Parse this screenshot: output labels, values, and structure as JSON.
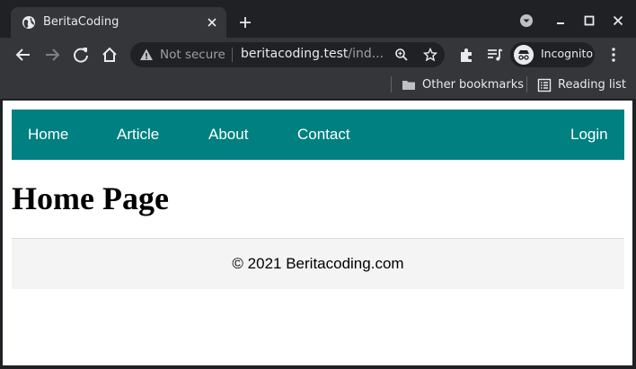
{
  "browser": {
    "tab": {
      "title": "BeritaCoding",
      "favicon": "globe-icon"
    },
    "omnibox": {
      "security_label": "Not secure",
      "url_host": "beritacoding.test",
      "url_path": "/ind..."
    },
    "profile": {
      "label": "Incognito"
    },
    "bookmarks": [
      {
        "label": "Other bookmarks",
        "icon": "folder-icon"
      },
      {
        "label": "Reading list",
        "icon": "reading-list-icon"
      }
    ]
  },
  "page": {
    "nav": {
      "links": [
        "Home",
        "Article",
        "About",
        "Contact"
      ],
      "login": "Login",
      "color": "#008080"
    },
    "heading": "Home Page",
    "footer": "© 2021 Beritacoding.com"
  }
}
